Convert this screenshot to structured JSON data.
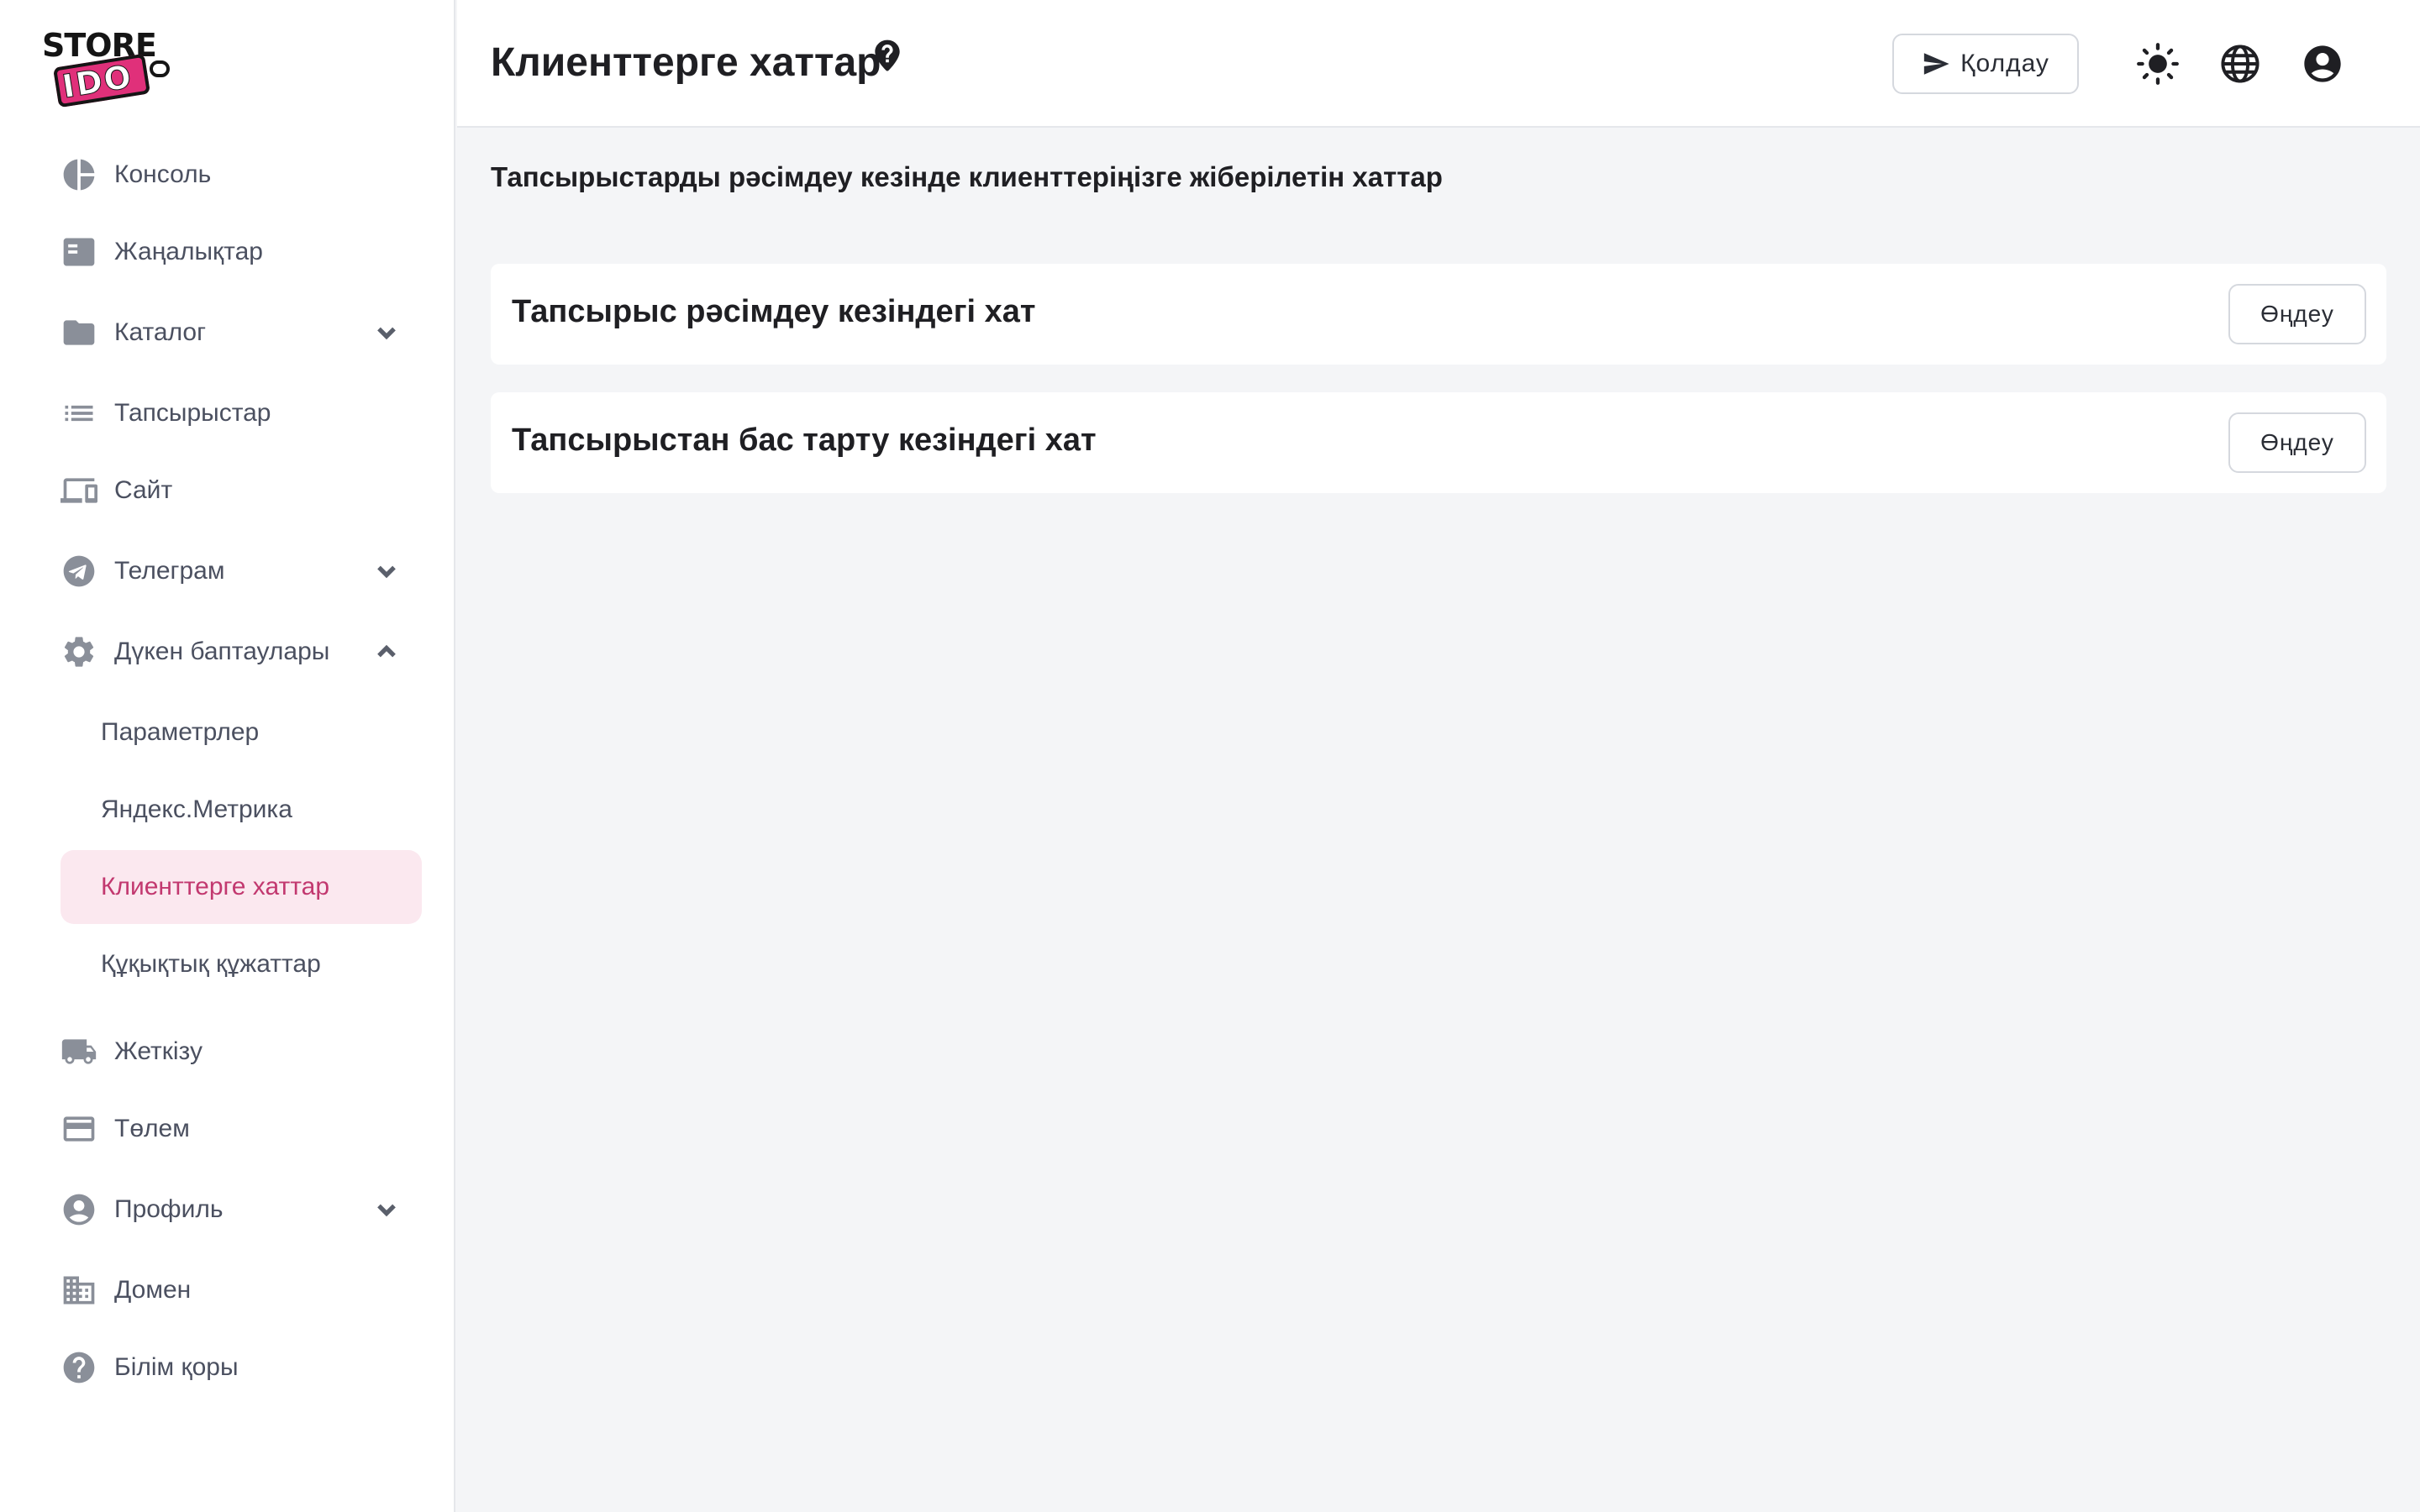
{
  "logo": {
    "top": "STORE",
    "bottom": "IDO"
  },
  "sidebar": {
    "items": [
      {
        "label": "Консоль",
        "icon": "pie-chart-icon"
      },
      {
        "label": "Жаңалықтар",
        "icon": "newspaper-icon"
      },
      {
        "label": "Каталог",
        "icon": "folder-icon",
        "expandable": true,
        "expanded": false
      },
      {
        "label": "Тапсырыстар",
        "icon": "list-icon"
      },
      {
        "label": "Сайт",
        "icon": "devices-icon"
      },
      {
        "label": "Телеграм",
        "icon": "telegram-icon",
        "expandable": true,
        "expanded": false
      },
      {
        "label": "Дүкен баптаулары",
        "icon": "gear-icon",
        "expandable": true,
        "expanded": true
      },
      {
        "label": "Жеткізу",
        "icon": "truck-icon"
      },
      {
        "label": "Төлем",
        "icon": "credit-card-icon"
      },
      {
        "label": "Профиль",
        "icon": "account-circle-icon",
        "expandable": true,
        "expanded": false
      },
      {
        "label": "Домен",
        "icon": "building-icon"
      },
      {
        "label": "Білім қоры",
        "icon": "help-circle-icon"
      }
    ],
    "subitems": [
      {
        "label": "Параметрлер",
        "active": false
      },
      {
        "label": "Яндекс.Метрика",
        "active": false
      },
      {
        "label": "Клиенттерге хаттар",
        "active": true
      },
      {
        "label": "Құқықтық құжаттар",
        "active": false
      }
    ]
  },
  "header": {
    "title": "Клиенттерге хаттар",
    "support_label": "Қолдау",
    "icons": [
      "theme-sun-icon",
      "language-globe-icon",
      "account-icon"
    ]
  },
  "main": {
    "subtitle": "Тапсырыстарды рәсімдеу кезінде клиенттеріңізге жіберілетін хаттар",
    "letters": [
      {
        "title": "Тапсырыс рәсімдеу кезіндегі хат",
        "action_label": "Өңдеу"
      },
      {
        "title": "Тапсырыстан бас тарту кезіндегі хат",
        "action_label": "Өңдеу"
      }
    ]
  },
  "colors": {
    "accent": "#c2386f",
    "accent_bg": "#fbe8ef",
    "brand_pink": "#e0307a",
    "icon_gray": "#8a8f99"
  }
}
